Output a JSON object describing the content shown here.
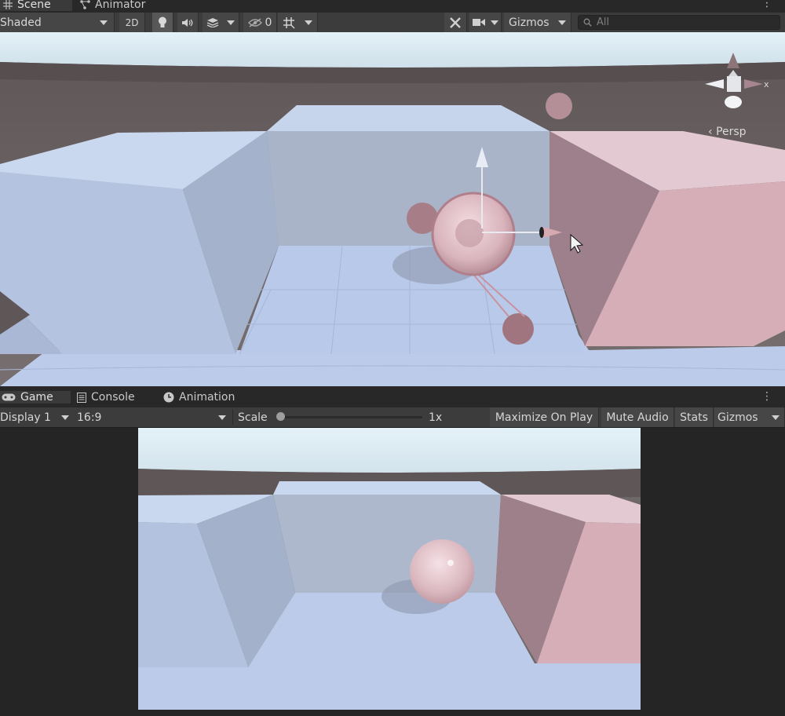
{
  "scene_tabs": [
    {
      "label": "Scene",
      "icon": "grid-icon",
      "active": true
    },
    {
      "label": "Animator",
      "icon": "animator-icon",
      "active": false
    }
  ],
  "scene_toolbar": {
    "draw_mode": "Shaded",
    "btn_2d": "2D",
    "hidden_count": "0",
    "gizmos": "Gizmos",
    "search_placeholder": "All"
  },
  "scene_view": {
    "projection_label": "Persp",
    "gizmo_axis": "x"
  },
  "game_tabs": [
    {
      "label": "Game",
      "icon": "gamepad-icon"
    },
    {
      "label": "Console",
      "icon": "console-icon"
    },
    {
      "label": "Animation",
      "icon": "clock-icon"
    }
  ],
  "game_toolbar": {
    "display": "Display 1",
    "aspect": "16:9",
    "scale_label": "Scale",
    "scale_value": "1x",
    "scale_level": 0,
    "maximize": "Maximize On Play",
    "mute": "Mute Audio",
    "stats": "Stats",
    "gizmos": "Gizmos"
  },
  "colors": {
    "editor_bg": "#282828",
    "toolbar_bg": "#3c3c3c",
    "sky": "#dcecf5",
    "ground": "#6f6868",
    "blue_box": "#b6c5df",
    "pink_box": "#d7b3bd",
    "floor": "#bccbea"
  }
}
